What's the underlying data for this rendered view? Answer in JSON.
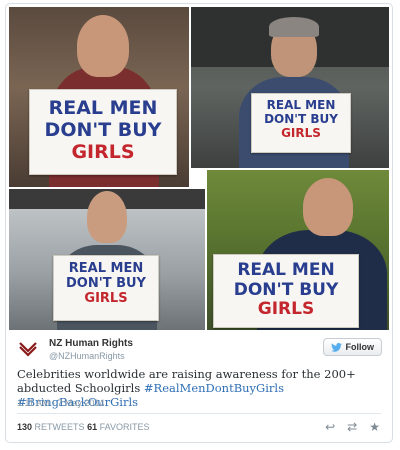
{
  "photos": [
    {
      "line1": "REAL MEN",
      "line2": "DON'T BUY",
      "line3": "GIRLS"
    },
    {
      "line1": "REAL MEN",
      "line2": "DON'T BUY",
      "line3": "GIRLS"
    },
    {
      "line1": "REAL MEN",
      "line2": "DON'T BUY",
      "line3": "GIRLS"
    },
    {
      "line1": "REAL MEN",
      "line2": "DON'T BUY",
      "line3": "GIRLS"
    }
  ],
  "account": {
    "name": "NZ Human Rights",
    "handle": "@NZHumanRights"
  },
  "follow_label": "Follow",
  "tweet": {
    "text": "Celebrities worldwide are raising awareness for the 200+ abducted Schoolgirls ",
    "hashtag1": "#RealMenDontBuyGirls",
    "hashtag2": "#BringBackOurGirls",
    "timestamp": "1:11 AM - 7 May 2014"
  },
  "stats": {
    "retweets": "130",
    "retweets_label": "RETWEETS",
    "favorites": "61",
    "favorites_label": "FAVORITES"
  },
  "colors": {
    "sign_blue": "#2a3e8f",
    "sign_red": "#c4262e",
    "hashtag": "#2f6fb5",
    "twitter_blue": "#55acee"
  },
  "icons": [
    "reply-icon",
    "retweet-icon",
    "favorite-icon",
    "twitter-bird-icon"
  ]
}
